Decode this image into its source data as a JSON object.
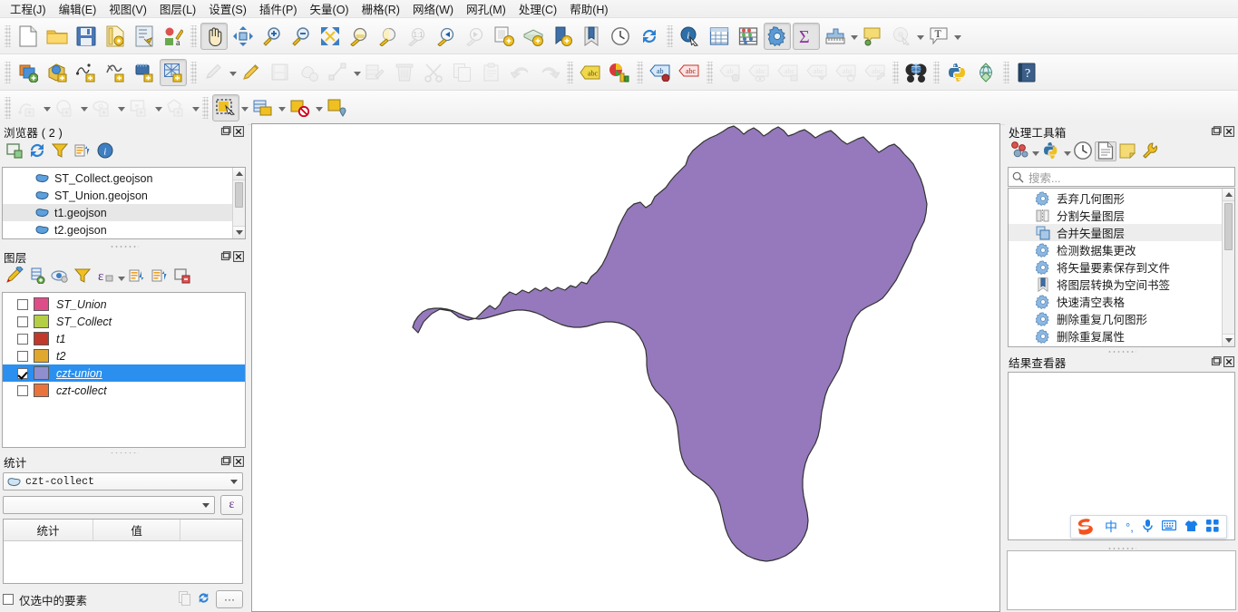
{
  "menubar": {
    "items": [
      {
        "label": "工程(J)",
        "name": "menu-project"
      },
      {
        "label": "编辑(E)",
        "name": "menu-edit"
      },
      {
        "label": "视图(V)",
        "name": "menu-view"
      },
      {
        "label": "图层(L)",
        "name": "menu-layer"
      },
      {
        "label": "设置(S)",
        "name": "menu-settings"
      },
      {
        "label": "插件(P)",
        "name": "menu-plugins"
      },
      {
        "label": "矢量(O)",
        "name": "menu-vector"
      },
      {
        "label": "栅格(R)",
        "name": "menu-raster"
      },
      {
        "label": "网络(W)",
        "name": "menu-web"
      },
      {
        "label": "网孔(M)",
        "name": "menu-mesh"
      },
      {
        "label": "处理(C)",
        "name": "menu-processing"
      },
      {
        "label": "帮助(H)",
        "name": "menu-help"
      }
    ]
  },
  "toolbar_rows": [
    {
      "name": "project-and-navigation-toolbar",
      "groups": [
        {
          "icons": [
            {
              "name": "new-project-icon",
              "glyph": "page"
            },
            {
              "name": "open-project-icon",
              "glyph": "folder"
            },
            {
              "name": "save-project-icon",
              "glyph": "save"
            },
            {
              "name": "new-print-layout-icon",
              "glyph": "layout"
            },
            {
              "name": "layout-manager-icon",
              "glyph": "layoutmgr"
            },
            {
              "name": "style-manager-icon",
              "glyph": "style"
            }
          ]
        },
        {
          "icons": [
            {
              "name": "pan-map-icon",
              "glyph": "hand",
              "state": "active"
            },
            {
              "name": "pan-to-selection-icon",
              "glyph": "pan-sel"
            },
            {
              "name": "zoom-in-icon",
              "glyph": "zoom-in"
            },
            {
              "name": "zoom-out-icon",
              "glyph": "zoom-out"
            },
            {
              "name": "zoom-full-icon",
              "glyph": "zoom-full"
            },
            {
              "name": "zoom-to-selection-icon",
              "glyph": "zoom-selection"
            },
            {
              "name": "zoom-to-layer-icon",
              "glyph": "zoom-layer"
            },
            {
              "name": "zoom-native-icon",
              "glyph": "zoom-1to1",
              "state": "disabled"
            },
            {
              "name": "zoom-last-icon",
              "glyph": "zoom-last"
            },
            {
              "name": "zoom-next-icon",
              "glyph": "zoom-next",
              "state": "disabled"
            },
            {
              "name": "new-map-view-icon",
              "glyph": "mapview"
            },
            {
              "name": "new-3d-map-view-icon",
              "glyph": "map3d"
            },
            {
              "name": "show-bookmarks-icon",
              "glyph": "bookmark-add"
            },
            {
              "name": "show-bookmark-manager-icon",
              "glyph": "bookmark"
            },
            {
              "name": "temporal-controller-icon",
              "glyph": "clock"
            },
            {
              "name": "refresh-map-icon",
              "glyph": "refresh"
            }
          ]
        },
        {
          "icons": [
            {
              "name": "identify-features-icon",
              "glyph": "identify"
            },
            {
              "name": "open-attribute-table-icon",
              "glyph": "table"
            },
            {
              "name": "field-calculator-icon",
              "glyph": "abacus"
            },
            {
              "name": "options-icon",
              "glyph": "gear",
              "state": "active"
            },
            {
              "name": "statistical-summary-icon",
              "glyph": "sigma",
              "state": "active"
            },
            {
              "name": "measure-line-icon",
              "glyph": "measure",
              "dropdown": true
            },
            {
              "name": "map-tips-icon",
              "glyph": "maptip"
            },
            {
              "name": "run-feature-action-icon",
              "glyph": "action",
              "state": "disabled",
              "dropdown": true
            },
            {
              "name": "text-annotation-icon",
              "glyph": "text-annotation",
              "dropdown": true
            }
          ]
        }
      ]
    },
    {
      "name": "data-source-and-digitizing-toolbar",
      "groups": [
        {
          "icons": [
            {
              "name": "add-vector-layer-icon",
              "glyph": "add-vector"
            },
            {
              "name": "add-raster-layer-icon",
              "glyph": "add-raster"
            },
            {
              "name": "add-delimited-text-layer-icon",
              "glyph": "add-delimited"
            },
            {
              "name": "add-spatialite-layer-icon",
              "glyph": "add-spatialite"
            },
            {
              "name": "add-postgis-layer-icon",
              "glyph": "add-postgis"
            },
            {
              "name": "add-mesh-layer-icon",
              "glyph": "add-mesh",
              "state": "active"
            }
          ]
        },
        {
          "icons": [
            {
              "name": "current-edits-icon",
              "glyph": "edits",
              "state": "disabled",
              "dropdown": true
            },
            {
              "name": "toggle-editing-icon",
              "glyph": "pencil"
            },
            {
              "name": "save-layer-edits-icon",
              "glyph": "save-edits",
              "state": "disabled"
            },
            {
              "name": "add-polygon-feature-icon",
              "glyph": "add-polygon",
              "state": "disabled"
            },
            {
              "name": "vertex-tool-icon",
              "glyph": "vertex",
              "state": "disabled",
              "dropdown": true
            },
            {
              "name": "modify-attributes-icon",
              "glyph": "modify-attrs",
              "state": "disabled"
            },
            {
              "name": "delete-selected-icon",
              "glyph": "trash",
              "state": "disabled"
            },
            {
              "name": "cut-features-icon",
              "glyph": "scissors",
              "state": "disabled"
            },
            {
              "name": "copy-features-icon",
              "glyph": "copy",
              "state": "disabled"
            },
            {
              "name": "paste-features-icon",
              "glyph": "paste",
              "state": "disabled"
            },
            {
              "name": "undo-icon",
              "glyph": "undo",
              "state": "disabled"
            },
            {
              "name": "redo-icon",
              "glyph": "redo",
              "state": "disabled"
            }
          ]
        },
        {
          "icons": [
            {
              "name": "layer-labeling-icon",
              "glyph": "label-yellow"
            },
            {
              "name": "layer-diagram-icon",
              "glyph": "diagram"
            }
          ]
        },
        {
          "icons": [
            {
              "name": "pin-labels-icon",
              "glyph": "label-pin-blue"
            },
            {
              "name": "highlight-pinned-labels-icon",
              "glyph": "label-pin-red"
            }
          ]
        },
        {
          "icons": [
            {
              "name": "move-label-icon",
              "glyph": "label-move",
              "state": "disabled"
            },
            {
              "name": "show-hide-labels-icon",
              "glyph": "label-hide",
              "state": "disabled"
            },
            {
              "name": "change-label-icon",
              "glyph": "label-change",
              "state": "disabled"
            },
            {
              "name": "rotate-label-icon",
              "glyph": "label-rotate",
              "state": "disabled"
            },
            {
              "name": "rotate-label-back-icon",
              "glyph": "label-rotate2",
              "state": "disabled"
            },
            {
              "name": "edit-label-icon",
              "glyph": "label-edit",
              "state": "disabled"
            }
          ]
        },
        {
          "icons": [
            {
              "name": "metasearch-icon",
              "glyph": "binoculars"
            }
          ]
        },
        {
          "icons": [
            {
              "name": "python-console-icon",
              "glyph": "python"
            },
            {
              "name": "crs-selector-icon",
              "glyph": "globe-crs"
            }
          ]
        },
        {
          "icons": [
            {
              "name": "help-contents-icon",
              "glyph": "help"
            }
          ]
        }
      ]
    },
    {
      "name": "shape-digitizing-and-selection-toolbar",
      "groups": [
        {
          "icons": [
            {
              "name": "add-circular-string-icon",
              "glyph": "circ-string",
              "state": "disabled",
              "dropdown": true
            },
            {
              "name": "add-circle-icon",
              "glyph": "circle",
              "state": "disabled",
              "dropdown": true
            },
            {
              "name": "add-ellipse-icon",
              "glyph": "ellipse",
              "state": "disabled",
              "dropdown": true
            },
            {
              "name": "add-rectangle-icon",
              "glyph": "rectangle",
              "state": "disabled",
              "dropdown": true
            },
            {
              "name": "add-regular-polygon-icon",
              "glyph": "regular-polygon",
              "state": "disabled",
              "dropdown": true
            }
          ]
        },
        {
          "icons": [
            {
              "name": "select-features-icon",
              "glyph": "select-rect",
              "state": "active",
              "dropdown": true
            },
            {
              "name": "select-by-expression-icon",
              "glyph": "select-form",
              "dropdown": true
            },
            {
              "name": "deselect-features-icon",
              "glyph": "deselect",
              "dropdown": true
            },
            {
              "name": "select-value-icon",
              "glyph": "select-value"
            }
          ]
        }
      ]
    }
  ],
  "browser_panel": {
    "title": "浏览器 ( 2 )",
    "name": "browser-panel",
    "tools": [
      {
        "name": "add-selected-layers-icon",
        "glyph": "add-layer-sq"
      },
      {
        "name": "refresh-browser-icon",
        "glyph": "refresh"
      },
      {
        "name": "filter-browser-icon",
        "glyph": "funnel"
      },
      {
        "name": "collapse-all-icon",
        "glyph": "collapse"
      },
      {
        "name": "browser-properties-icon",
        "glyph": "info"
      }
    ],
    "items": [
      {
        "label": "ST_Collect.geojson",
        "selected": false
      },
      {
        "label": "ST_Union.geojson",
        "selected": false
      },
      {
        "label": "t1.geojson",
        "selected": true
      },
      {
        "label": "t2.geojson",
        "selected": false
      }
    ]
  },
  "layers_panel": {
    "title": "图层",
    "name": "layers-panel",
    "tools": [
      {
        "name": "open-layer-styling-panel-icon",
        "glyph": "paintbrush"
      },
      {
        "name": "add-group-icon",
        "glyph": "add-group"
      },
      {
        "name": "manage-map-themes-icon",
        "glyph": "eye"
      },
      {
        "name": "filter-legend-icon",
        "glyph": "funnel"
      },
      {
        "name": "filter-legend-by-expression-icon",
        "glyph": "epsilon",
        "dropdown": true
      },
      {
        "name": "expand-all-icon",
        "glyph": "expand-all"
      },
      {
        "name": "collapse-all-icon",
        "glyph": "collapse"
      },
      {
        "name": "remove-layer-icon",
        "glyph": "remove-layer"
      }
    ],
    "layers": [
      {
        "name": "ST_Union",
        "checked": false,
        "color": "#DE4D87",
        "selected": false
      },
      {
        "name": "ST_Collect",
        "checked": false,
        "color": "#B4CE45",
        "selected": false
      },
      {
        "name": "t1",
        "checked": false,
        "color": "#C0392B",
        "selected": false
      },
      {
        "name": "t2",
        "checked": false,
        "color": "#E0A82E",
        "selected": false
      },
      {
        "name": "czt-union",
        "checked": true,
        "color": "#8F8FD0",
        "selected": true
      },
      {
        "name": "czt-collect",
        "checked": false,
        "color": "#E8743B",
        "selected": false
      }
    ]
  },
  "statistics_panel": {
    "title": "统计",
    "name": "statistics-panel",
    "layer_value": "czt-collect",
    "field_value": "",
    "expression_button": "ε",
    "columns": [
      "统计",
      "值"
    ],
    "rows": [],
    "selected_only_label": "仅选中的要素",
    "selected_only_checked": false,
    "footer_icons": [
      {
        "name": "copy-statistics-icon",
        "glyph": "copy",
        "state": "disabled"
      },
      {
        "name": "recalculate-statistics-icon",
        "glyph": "refresh"
      },
      {
        "name": "statistics-options-icon",
        "glyph": "ellipsis",
        "dropdown": true
      }
    ]
  },
  "processing_panel": {
    "title": "处理工具箱",
    "name": "processing-toolbox-panel",
    "tools": [
      {
        "name": "models-icon",
        "glyph": "models",
        "dropdown": true
      },
      {
        "name": "scripts-icon",
        "glyph": "python-script",
        "dropdown": true
      },
      {
        "name": "history-icon",
        "glyph": "clock"
      },
      {
        "name": "results-viewer-icon",
        "glyph": "doc",
        "state": "active"
      },
      {
        "name": "edit-model-icon",
        "glyph": "note"
      },
      {
        "name": "processing-options-icon",
        "glyph": "wrench"
      }
    ],
    "search_placeholder": "搜索...",
    "search_value": "",
    "algorithms": [
      {
        "label": "丢弃几何图形",
        "icon": "gear-blue",
        "selected": false
      },
      {
        "label": "分割矢量图层",
        "icon": "split",
        "selected": false
      },
      {
        "label": "合并矢量图层",
        "icon": "merge",
        "selected": true
      },
      {
        "label": "检测数据集更改",
        "icon": "gear-blue",
        "selected": false
      },
      {
        "label": "将矢量要素保存到文件",
        "icon": "gear-blue",
        "selected": false
      },
      {
        "label": "将图层转换为空间书签",
        "icon": "bookmark",
        "selected": false
      },
      {
        "label": "快速清空表格",
        "icon": "gear-blue",
        "selected": false
      },
      {
        "label": "删除重复几何图形",
        "icon": "gear-blue",
        "selected": false
      },
      {
        "label": "删除重复属性",
        "icon": "gear-blue",
        "selected": false
      }
    ]
  },
  "results_panel": {
    "title": "结果查看器",
    "name": "results-viewer-panel",
    "content": ""
  },
  "map_canvas": {
    "name": "map-canvas",
    "background": "#ffffff",
    "feature_name": "czt-union",
    "fill_color": "#9579BC",
    "stroke_color": "#333333"
  },
  "ime_bar": {
    "name": "sogou-ime-bar",
    "logo_text": "S",
    "buttons": [
      {
        "name": "ime-chinese-mode-button",
        "label": "中"
      },
      {
        "name": "ime-punctuation-button",
        "label": "°,"
      },
      {
        "name": "ime-voice-input-button",
        "label": "mic"
      },
      {
        "name": "ime-soft-keyboard-button",
        "label": "keyboard"
      },
      {
        "name": "ime-skin-button",
        "label": "shirt"
      },
      {
        "name": "ime-toolbox-button",
        "label": "grid"
      }
    ]
  },
  "panel_buttons": {
    "float": "float-panel-icon",
    "close": "close-panel-icon"
  }
}
